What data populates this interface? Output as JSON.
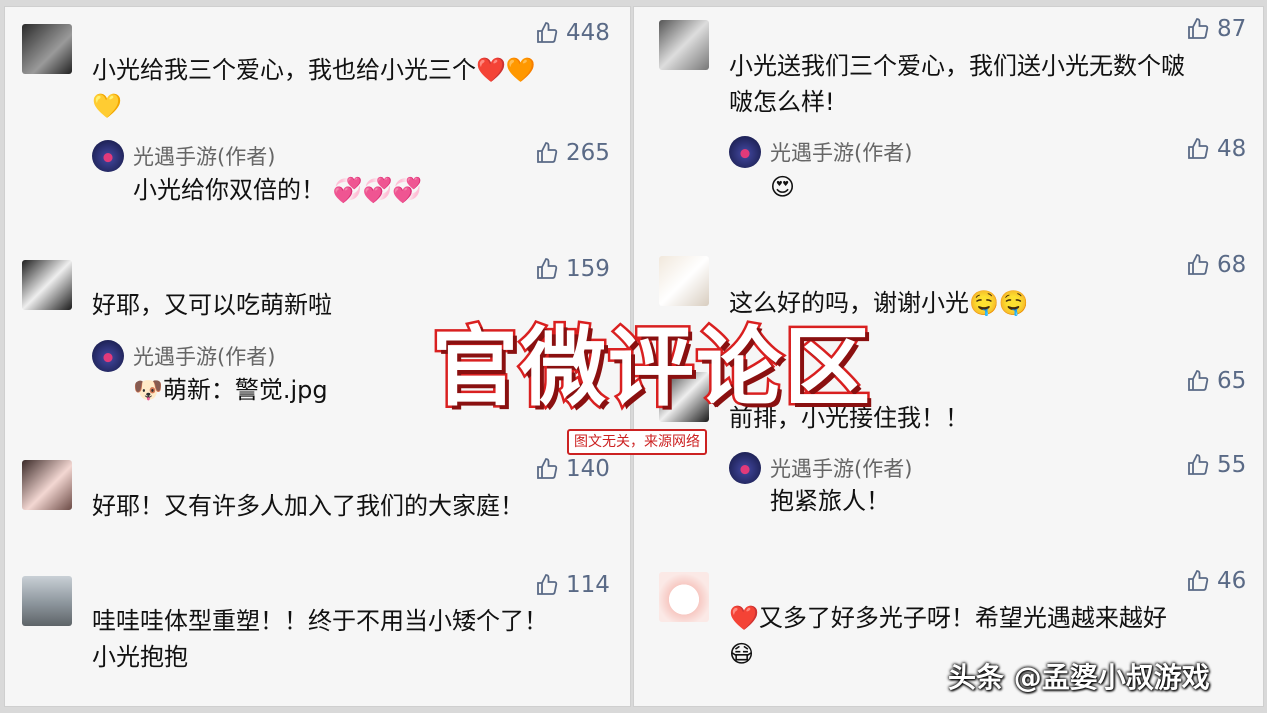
{
  "left_column": [
    {
      "likes": "448",
      "text_lines": [
        "小光给我三个爱心，我也给小光三个❤️🧡",
        "💛"
      ],
      "reply": {
        "author": "光遇手游(作者)",
        "text": "小光给你双倍的！ 💞💞💞",
        "likes": "265"
      }
    },
    {
      "likes": "159",
      "text_lines": [
        "好耶，又可以吃萌新啦"
      ],
      "reply": {
        "author": "光遇手游(作者)",
        "text": "🐶萌新：警觉.jpg",
        "likes": ""
      }
    },
    {
      "likes": "140",
      "text_lines": [
        "好耶！又有许多人加入了我们的大家庭！"
      ]
    },
    {
      "likes": "114",
      "text_lines": [
        "哇哇哇体型重塑！！终于不用当小矮个了！",
        "小光抱抱"
      ]
    }
  ],
  "right_column": [
    {
      "likes": "87",
      "text_lines": [
        "小光送我们三个爱心，我们送小光无数个啵",
        "啵怎么样!"
      ],
      "reply": {
        "author": "光遇手游(作者)",
        "text": "😍",
        "likes": "48"
      }
    },
    {
      "likes": "68",
      "text_lines": [
        "这么好的吗，谢谢小光🤤🤤"
      ]
    },
    {
      "likes": "65",
      "text_lines": [
        "前排，小光接住我！！"
      ],
      "reply": {
        "author": "光遇手游(作者)",
        "text": "抱紧旅人！",
        "likes": "55"
      }
    },
    {
      "likes": "46",
      "text_lines": [
        "❤️又多了好多光子呀！希望光遇越来越好",
        "😷"
      ]
    }
  ],
  "overlay": {
    "title": "官微评论区",
    "subtitle": "图文无关，来源网络"
  },
  "watermark": "头条 @孟婆小叔游戏",
  "colors": {
    "like_blue": "#5a6a86",
    "title_red": "#d92020"
  }
}
